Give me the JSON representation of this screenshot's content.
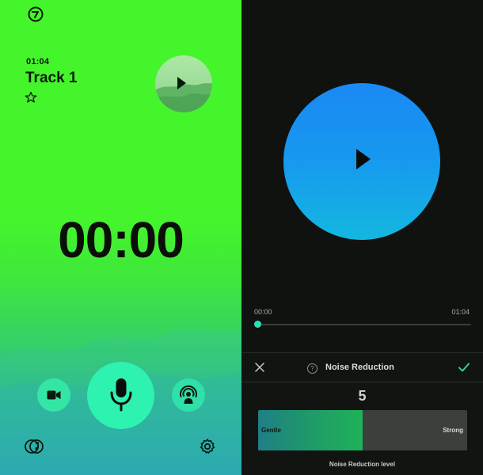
{
  "recorder": {
    "track_time": "01:04",
    "track_title": "Track 1",
    "timer": "00:00"
  },
  "player": {
    "time_start": "00:00",
    "time_end": "01:04",
    "progress": 0.0
  },
  "noise_reduction": {
    "title": "Noise Reduction",
    "help": "?",
    "value": "5",
    "level_fraction": 0.5,
    "gentle_label": "Gentle",
    "strong_label": "Strong",
    "caption": "Noise Reduction level"
  },
  "icons": [
    "app-logo-icon",
    "star-icon",
    "play-icon",
    "video-camera-icon",
    "microphone-icon",
    "live-broadcast-icon",
    "music-library-icon",
    "gear-icon",
    "close-icon",
    "help-icon",
    "checkmark-icon"
  ],
  "colors": {
    "left_bg_top": "#45f52c",
    "left_bg_bottom": "#2a9fb6",
    "accent_mint": "#2df2b0",
    "disc_blue": "#1a89f5",
    "dark_bg": "#101210"
  }
}
